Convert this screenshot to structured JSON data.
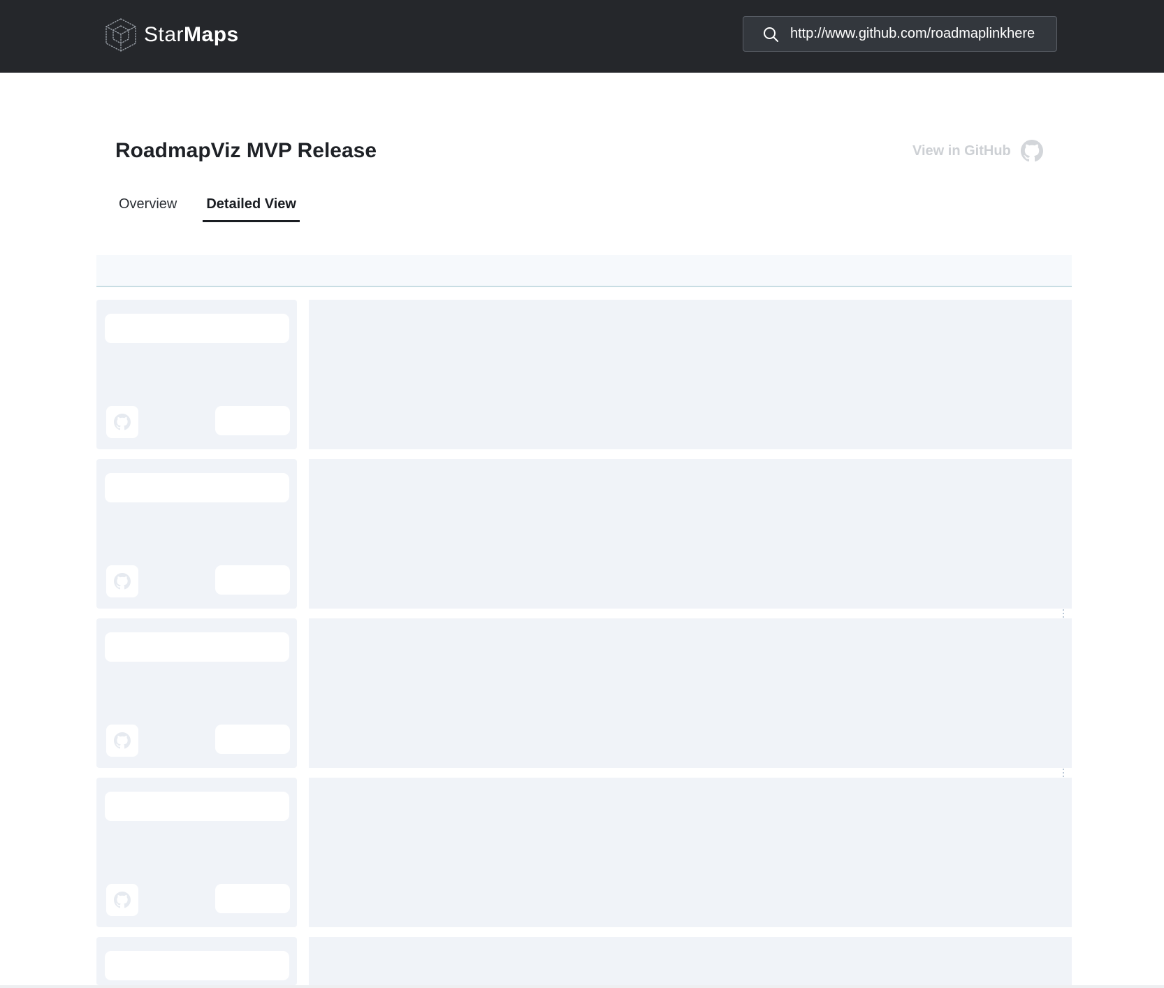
{
  "brand": {
    "name_light": "Star",
    "name_bold": "Maps"
  },
  "search": {
    "value": "http://www.github.com/roadmaplinkhere"
  },
  "page": {
    "title": "RoadmapViz MVP Release",
    "view_in_github": "View in GitHub"
  },
  "tabs": [
    {
      "label": "Overview",
      "active": false
    },
    {
      "label": "Detailed View",
      "active": true
    }
  ],
  "icons": {
    "logo": "cube-logo-icon",
    "search": "search-icon",
    "github": "github-icon"
  },
  "colors": {
    "header_bg": "#25272b",
    "skeleton": "#f0f3f8",
    "link_muted": "#cdd0d4",
    "divider": "#c8dde3"
  }
}
